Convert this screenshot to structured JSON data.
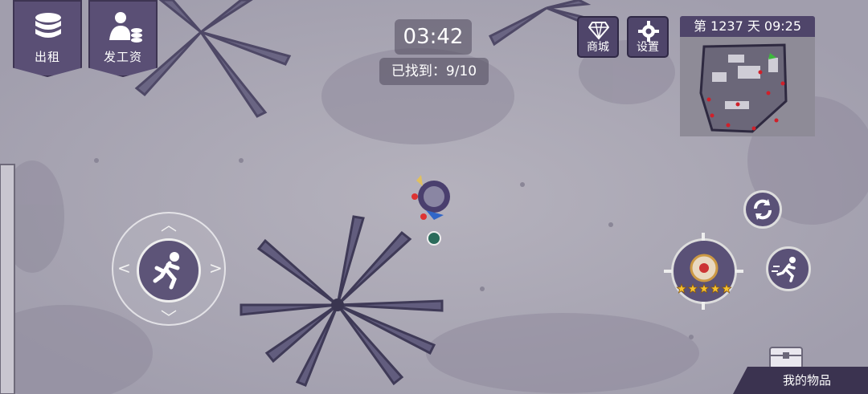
{
  "hud": {
    "rent_label": "出租",
    "pay_label": "发工资",
    "timer": "03:42",
    "found_text": "已找到：9/10",
    "shop_label": "商城",
    "settings_label": "设置",
    "day_time": "第 1237 天  09:25",
    "items_label": "我的物品"
  },
  "icons": {
    "rent": "coin-stack-icon",
    "pay": "worker-coins-icon",
    "shop": "diamond-icon",
    "settings": "gear-icon",
    "run": "running-man-icon",
    "refresh": "refresh-icon",
    "sprint": "sprint-icon",
    "items": "chest-icon"
  },
  "skill": {
    "stars": 5
  },
  "colors": {
    "panel": "#5a4f75",
    "ground": "#a9a6b1",
    "minimap_marker": "#d0202a",
    "player_arrow": "#3db83d"
  }
}
